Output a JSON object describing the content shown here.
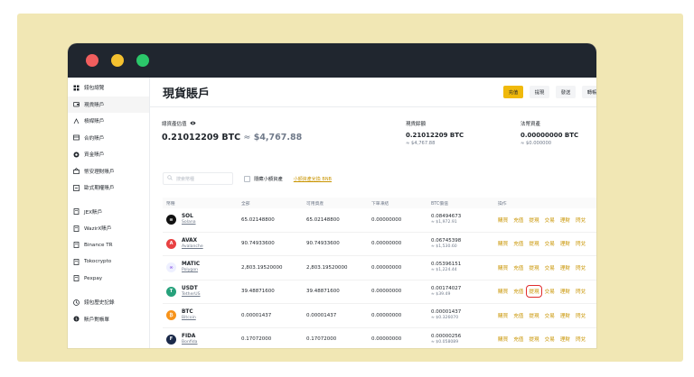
{
  "sidebar": {
    "items": [
      {
        "label": "錢包總覽",
        "icon": "grid-icon"
      },
      {
        "label": "現貨賬戶",
        "icon": "wallet-icon",
        "active": true
      },
      {
        "label": "槓桿賬戶",
        "icon": "margin-icon"
      },
      {
        "label": "合約賬戶",
        "icon": "futures-icon"
      },
      {
        "label": "資金賬戶",
        "icon": "funding-icon"
      },
      {
        "label": "幣安理財賬戶",
        "icon": "earn-icon"
      },
      {
        "label": "歐式期權賬戶",
        "icon": "options-icon"
      },
      {
        "label": "JEX賬戶",
        "icon": "jex-icon"
      },
      {
        "label": "WazirX賬戶",
        "icon": "wazirx-icon"
      },
      {
        "label": "Binance TR",
        "icon": "binance-tr-icon"
      },
      {
        "label": "Tokocrypto",
        "icon": "tokocrypto-icon"
      },
      {
        "label": "Pexpay",
        "icon": "pexpay-icon"
      },
      {
        "label": "錢包歷史記錄",
        "icon": "history-icon"
      },
      {
        "label": "賬戶對帳單",
        "icon": "statement-icon"
      }
    ]
  },
  "header": {
    "title": "現貨賬戶",
    "buttons": [
      {
        "label": "充值",
        "primary": true
      },
      {
        "label": "提現"
      },
      {
        "label": "發送"
      },
      {
        "label": "轉帳"
      }
    ]
  },
  "balances": {
    "total_label": "總資產估值",
    "total_btc": "0.21012209 BTC",
    "approx": "≈",
    "total_usd": "$4,767.88",
    "spot_label": "現貨餘額",
    "spot_btc": "0.21012209 BTC",
    "spot_usd": "≈ $4,767.88",
    "fiat_label": "法幣資產",
    "fiat_btc": "0.00000000 BTC",
    "fiat_usd": "≈ $0.000000"
  },
  "filters": {
    "search_placeholder": "搜索幣種",
    "hide_small": "隱藏小額資產",
    "convert_link": "小額資產兌換 BNB"
  },
  "table": {
    "headers": {
      "coin": "幣種",
      "total": "全部",
      "available": "可用資產",
      "in_order": "下單凍結",
      "btc_value": "BTC價值",
      "actions": "操作"
    },
    "rows": [
      {
        "symbol": "SOL",
        "name": "Solana",
        "total": "65.02148800",
        "available": "65.02148800",
        "in_order": "0.00000000",
        "btc": "0.08494673",
        "usd": "≈ $1,972.91",
        "logo_color": "#111111",
        "logo_text": "≡",
        "actions": [
          "購買",
          "充值",
          "提現",
          "交易",
          "理財",
          "閃兌"
        ]
      },
      {
        "symbol": "AVAX",
        "name": "Avalanche",
        "total": "90.74933600",
        "available": "90.74933600",
        "in_order": "0.00000000",
        "btc": "0.06745398",
        "usd": "≈ $1,530.60",
        "logo_color": "#e84142",
        "logo_text": "A",
        "actions": [
          "購買",
          "充值",
          "提現",
          "交易",
          "理財",
          "閃兌"
        ]
      },
      {
        "symbol": "MATIC",
        "name": "Polygon",
        "total": "2,803.19520000",
        "available": "2,803.19520000",
        "in_order": "0.00000000",
        "btc": "0.05396151",
        "usd": "≈ $1,224.44",
        "logo_color": "#eef0ff",
        "logo_text": "∞",
        "actions": [
          "購買",
          "充值",
          "提現",
          "交易",
          "理財",
          "閃兌"
        ]
      },
      {
        "symbol": "USDT",
        "name": "TetherUS",
        "total": "39.48871600",
        "available": "39.48871600",
        "in_order": "0.00000000",
        "btc": "0.00174027",
        "usd": "≈ $39.49",
        "logo_color": "#26a17b",
        "logo_text": "T",
        "actions": [
          "購買",
          "充值",
          "提現",
          "交易",
          "理財",
          "閃兌"
        ],
        "highlight_index": 2
      },
      {
        "symbol": "BTC",
        "name": "Bitcoin",
        "total": "0.00001437",
        "available": "0.00001437",
        "in_order": "0.00000000",
        "btc": "0.00001437",
        "usd": "≈ $0.326070",
        "logo_color": "#f7931a",
        "logo_text": "₿",
        "actions": [
          "購買",
          "充值",
          "提現",
          "交易",
          "理財",
          "閃兌"
        ]
      },
      {
        "symbol": "FIDA",
        "name": "Bonfida",
        "total": "0.17072000",
        "available": "0.17072000",
        "in_order": "0.00000000",
        "btc": "0.00000256",
        "usd": "≈ $0.058089",
        "logo_color": "#1b2a4a",
        "logo_text": "F",
        "actions": [
          "購買",
          "充值",
          "提現",
          "交易",
          "理財",
          "閃兌"
        ]
      }
    ]
  },
  "colors": {
    "accent": "#f0b90b",
    "link": "#c99400",
    "highlight": "#e02d2d",
    "titlebar": "#20262f",
    "backdrop": "#f1e7b4"
  }
}
